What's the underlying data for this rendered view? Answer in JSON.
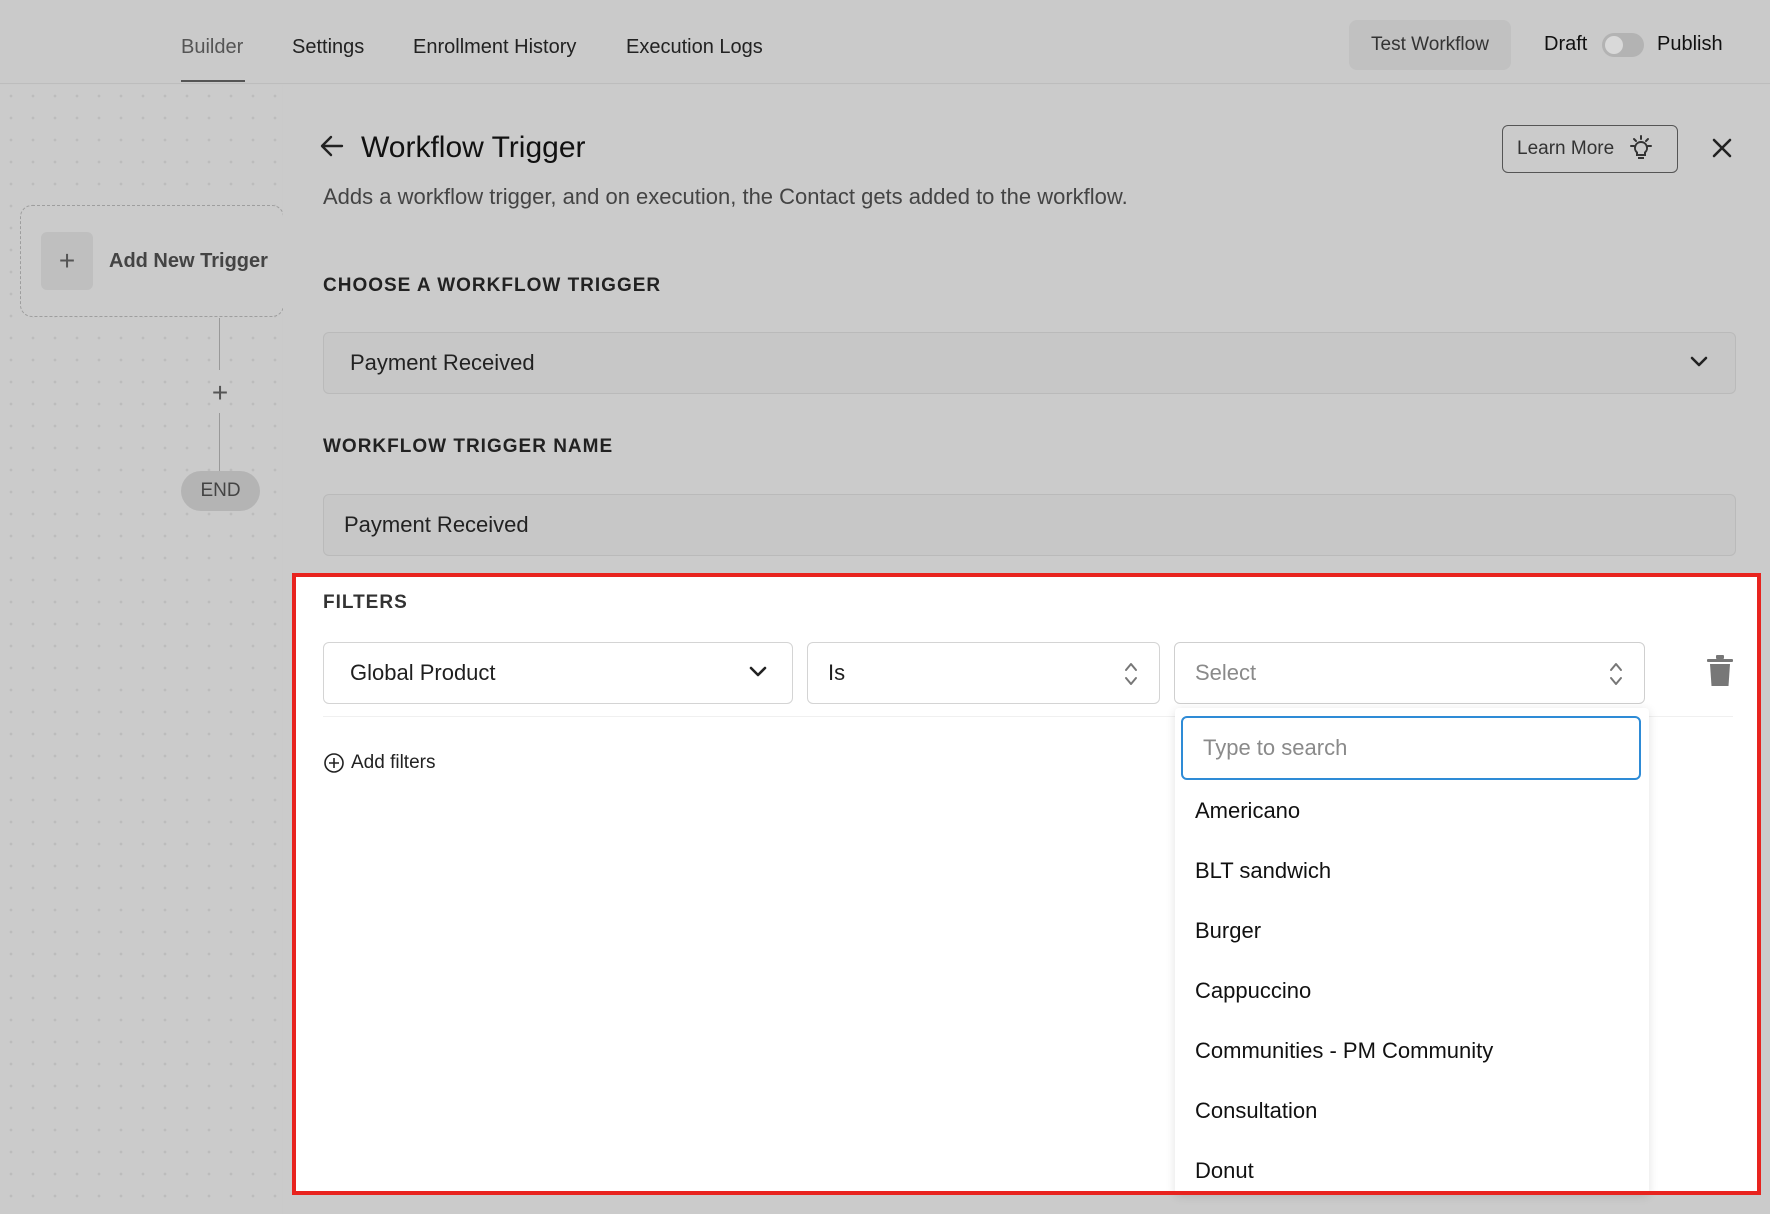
{
  "topbar": {
    "tabs": [
      {
        "label": "Builder",
        "active": true
      },
      {
        "label": "Settings",
        "active": false
      },
      {
        "label": "Enrollment History",
        "active": false
      },
      {
        "label": "Execution Logs",
        "active": false
      }
    ],
    "test_workflow_label": "Test Workflow",
    "draft_label": "Draft",
    "publish_label": "Publish",
    "publish_toggle_on": false
  },
  "canvas": {
    "trigger_label": "Add New Trigger",
    "end_label": "END"
  },
  "panel": {
    "title": "Workflow Trigger",
    "description": "Adds a workflow trigger, and on execution, the Contact gets added to the workflow.",
    "learn_more_label": "Learn More",
    "choose_trigger_label": "CHOOSE A WORKFLOW TRIGGER",
    "trigger_value": "Payment Received",
    "trigger_name_label": "WORKFLOW TRIGGER NAME",
    "trigger_name_value": "Payment Received"
  },
  "filters": {
    "label": "FILTERS",
    "field_value": "Global Product",
    "operator_value": "Is",
    "value_placeholder": "Select",
    "add_filters_label": "Add filters",
    "search_placeholder": "Type to search",
    "options": [
      "Americano",
      "BLT sandwich",
      "Burger",
      "Cappuccino",
      "Communities - PM Community",
      "Consultation",
      "Donut"
    ]
  },
  "colors": {
    "highlight": "#e8231e",
    "search_focus": "#2e8bd6",
    "overlay_bg": "#cacaca"
  },
  "icons": [
    "plus-icon",
    "arrow-left-icon",
    "lightbulb-icon",
    "close-icon",
    "chevron-down-icon",
    "updown-chevron-icon",
    "trash-icon",
    "plus-circle-icon"
  ]
}
